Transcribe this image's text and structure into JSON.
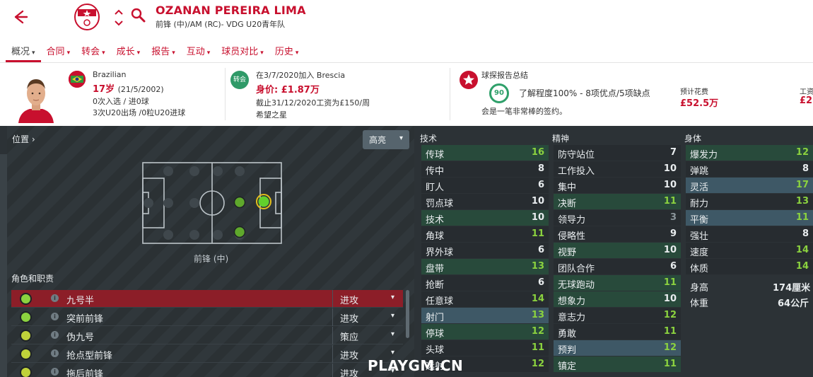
{
  "header": {
    "player_name": "OZANAN PEREIRA LIMA",
    "player_sub": "前锋 (中)/AM (RC)- VDG U20青年队"
  },
  "tabs": [
    {
      "label": "概况",
      "active": true
    },
    {
      "label": "合同"
    },
    {
      "label": "转会"
    },
    {
      "label": "成长"
    },
    {
      "label": "报告"
    },
    {
      "label": "互动"
    },
    {
      "label": "球员对比"
    },
    {
      "label": "历史"
    }
  ],
  "info": {
    "nationality": "Brazilian",
    "age": "17岁",
    "dob": "(21/5/2002)",
    "caps": "0次入选 / 进0球",
    "u20": "3次U20出场 /0粒U20进球",
    "transfer_badge": "转会",
    "joined": "在3/7/2020加入 Brescia",
    "value_label": "身价:",
    "value": "£1.87万",
    "contract": "截止31/12/2020工资为£150/周",
    "status": "希望之星",
    "scout_title": "球探报告总结",
    "potential": "90",
    "knowledge": "了解程度100% - 8项优点/5项缺点",
    "verdict": "会是一笔非常棒的签约。",
    "est_fee_label": "预计花费",
    "est_fee": "£52.5万",
    "wage_label_partial": "工资",
    "wage_partial": "£2"
  },
  "positions": {
    "title": "位置",
    "highlight_label": "高亮",
    "position_label": "前锋 (中)"
  },
  "roles": {
    "title": "角色和职责",
    "items": [
      {
        "name": "九号半",
        "duty": "进攻",
        "selected": true,
        "dot": "#8bd23f"
      },
      {
        "name": "突前前锋",
        "duty": "进攻",
        "dot": "#8bd23f"
      },
      {
        "name": "伪九号",
        "duty": "策应",
        "dot": "#c0d23a"
      },
      {
        "name": "抢点型前锋",
        "duty": "进攻",
        "dot": "#c0d23a"
      },
      {
        "name": "拖后前锋",
        "duty": "进攻",
        "dot": "#c0d23a"
      }
    ]
  },
  "attributes": {
    "technical_title": "技术",
    "mental_title": "精神",
    "physical_title": "身体",
    "technical": [
      {
        "name": "传球",
        "value": "16",
        "style": "st",
        "color": "green"
      },
      {
        "name": "传中",
        "value": "8",
        "style": "",
        "color": "white"
      },
      {
        "name": "盯人",
        "value": "6",
        "style": "",
        "color": "white"
      },
      {
        "name": "罚点球",
        "value": "10",
        "style": "",
        "color": "white"
      },
      {
        "name": "技术",
        "value": "10",
        "style": "st",
        "color": "white"
      },
      {
        "name": "角球",
        "value": "11",
        "style": "",
        "color": "green"
      },
      {
        "name": "界外球",
        "value": "6",
        "style": "",
        "color": "white"
      },
      {
        "name": "盘带",
        "value": "13",
        "style": "st",
        "color": "green"
      },
      {
        "name": "抢断",
        "value": "6",
        "style": "",
        "color": "white"
      },
      {
        "name": "任意球",
        "value": "14",
        "style": "",
        "color": "green"
      },
      {
        "name": "射门",
        "value": "13",
        "style": "hl",
        "color": "green"
      },
      {
        "name": "停球",
        "value": "12",
        "style": "st",
        "color": "green"
      },
      {
        "name": "头球",
        "value": "11",
        "style": "",
        "color": "green"
      },
      {
        "name": "远射",
        "value": "12",
        "style": "",
        "color": "green"
      }
    ],
    "mental": [
      {
        "name": "防守站位",
        "value": "7",
        "style": "",
        "color": "white"
      },
      {
        "name": "工作投入",
        "value": "10",
        "style": "",
        "color": "white"
      },
      {
        "name": "集中",
        "value": "10",
        "style": "",
        "color": "white"
      },
      {
        "name": "决断",
        "value": "11",
        "style": "st",
        "color": "green"
      },
      {
        "name": "领导力",
        "value": "3",
        "style": "",
        "color": "dim"
      },
      {
        "name": "侵略性",
        "value": "9",
        "style": "",
        "color": "white"
      },
      {
        "name": "视野",
        "value": "10",
        "style": "st",
        "color": "white"
      },
      {
        "name": "团队合作",
        "value": "6",
        "style": "",
        "color": "white"
      },
      {
        "name": "无球跑动",
        "value": "11",
        "style": "st",
        "color": "green"
      },
      {
        "name": "想象力",
        "value": "10",
        "style": "st",
        "color": "white"
      },
      {
        "name": "意志力",
        "value": "12",
        "style": "",
        "color": "green"
      },
      {
        "name": "勇敢",
        "value": "11",
        "style": "",
        "color": "green"
      },
      {
        "name": "预判",
        "value": "12",
        "style": "hl",
        "color": "green"
      },
      {
        "name": "镇定",
        "value": "11",
        "style": "st",
        "color": "green"
      }
    ],
    "physical": [
      {
        "name": "爆发力",
        "value": "12",
        "style": "st",
        "color": "green"
      },
      {
        "name": "弹跳",
        "value": "8",
        "style": "",
        "color": "white"
      },
      {
        "name": "灵活",
        "value": "17",
        "style": "hl",
        "color": "green"
      },
      {
        "name": "耐力",
        "value": "13",
        "style": "",
        "color": "green"
      },
      {
        "name": "平衡",
        "value": "11",
        "style": "hl",
        "color": "green"
      },
      {
        "name": "强壮",
        "value": "8",
        "style": "",
        "color": "white"
      },
      {
        "name": "速度",
        "value": "14",
        "style": "",
        "color": "green"
      },
      {
        "name": "体质",
        "value": "14",
        "style": "",
        "color": "green"
      }
    ],
    "height_label": "身高",
    "height": "174厘米",
    "weight_label": "体重",
    "weight": "64公斤"
  },
  "watermark": "PLAYGM.CN"
}
